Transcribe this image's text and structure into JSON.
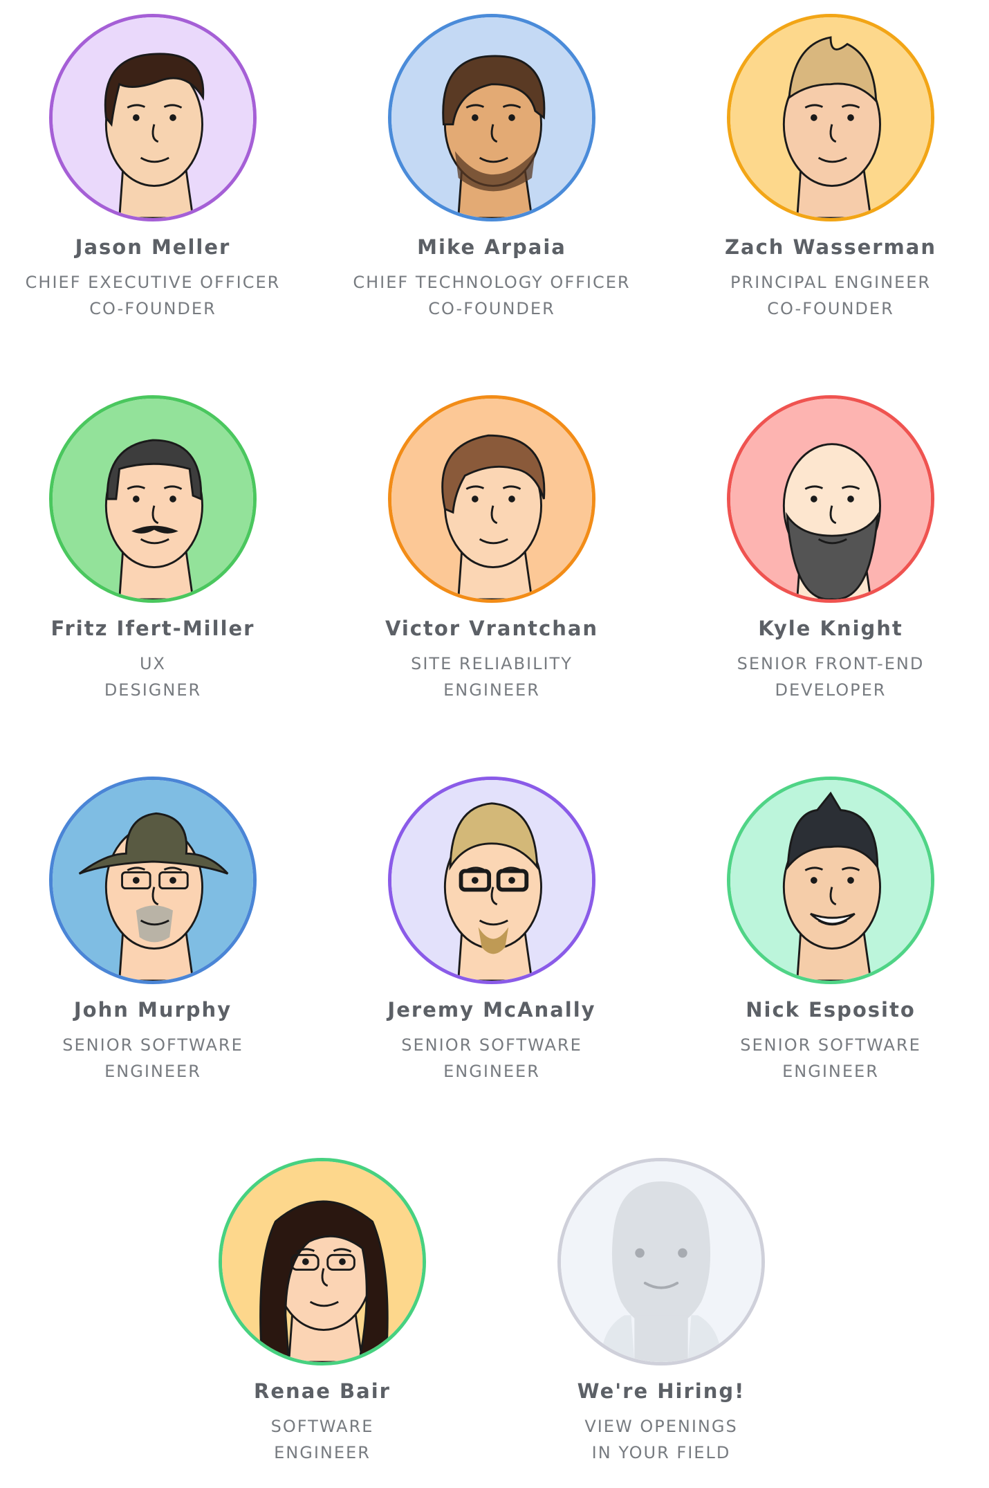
{
  "team": [
    {
      "name": "Jason Meller",
      "role_line1": "CHIEF EXECUTIVE OFFICER",
      "role_line2": "CO-FOUNDER",
      "ring": "#a55fd6",
      "bg": "#ead9fb",
      "skin": "#f7d3b0",
      "hair": "#3b2216",
      "avatar_icon": "jason-portrait-icon"
    },
    {
      "name": "Mike Arpaia",
      "role_line1": "CHIEF TECHNOLOGY OFFICER",
      "role_line2": "CO-FOUNDER",
      "ring": "#4a8bd9",
      "bg": "#c4d9f4",
      "skin": "#e3aa74",
      "hair": "#5a3a24",
      "avatar_icon": "mike-portrait-icon"
    },
    {
      "name": "Zach Wasserman",
      "role_line1": "PRINCIPAL ENGINEER",
      "role_line2": "CO-FOUNDER",
      "ring": "#f2a516",
      "bg": "#fdd88c",
      "skin": "#f6ccaa",
      "hair": "#d9b77e",
      "avatar_icon": "zach-portrait-icon"
    },
    {
      "name": "Fritz Ifert-Miller",
      "role_line1": "UX",
      "role_line2": "DESIGNER",
      "ring": "#4ac75e",
      "bg": "#93e29a",
      "skin": "#fbd4b4",
      "hair": "#3d3d3d",
      "avatar_icon": "fritz-portrait-icon"
    },
    {
      "name": "Victor Vrantchan",
      "role_line1": "SITE RELIABILITY",
      "role_line2": "ENGINEER",
      "ring": "#f28c17",
      "bg": "#fcc896",
      "skin": "#fbd6b4",
      "hair": "#8a5a3a",
      "avatar_icon": "victor-portrait-icon"
    },
    {
      "name": "Kyle Knight",
      "role_line1": "SENIOR FRONT-END",
      "role_line2": "DEVELOPER",
      "ring": "#ef5350",
      "bg": "#fdb4b1",
      "skin": "#fde6cf",
      "hair": "#545454",
      "avatar_icon": "kyle-portrait-icon"
    },
    {
      "name": "John Murphy",
      "role_line1": "SENIOR SOFTWARE",
      "role_line2": "ENGINEER",
      "ring": "#4a85d6",
      "bg": "#7fbde3",
      "skin": "#fbd3b2",
      "hair": "#595a42",
      "avatar_icon": "john-portrait-icon"
    },
    {
      "name": "Jeremy McAnally",
      "role_line1": "SENIOR SOFTWARE",
      "role_line2": "ENGINEER",
      "ring": "#8a5be8",
      "bg": "#e3e1fb",
      "skin": "#fbd6b4",
      "hair": "#d3b878",
      "avatar_icon": "jeremy-portrait-icon"
    },
    {
      "name": "Nick Esposito",
      "role_line1": "SENIOR SOFTWARE",
      "role_line2": "ENGINEER",
      "ring": "#4fd486",
      "bg": "#bcf5db",
      "skin": "#f5cda9",
      "hair": "#2b2f35",
      "avatar_icon": "nick-portrait-icon"
    },
    {
      "name": "Renae Bair",
      "role_line1": "SOFTWARE",
      "role_line2": "ENGINEER",
      "ring": "#47d180",
      "bg": "#fdd78c",
      "skin": "#fbd4b4",
      "hair": "#2a1710",
      "avatar_icon": "renae-portrait-icon"
    }
  ],
  "hiring": {
    "name": "We're Hiring!",
    "role_line1": "VIEW OPENINGS",
    "role_line2": "IN YOUR FIELD",
    "ring": "#cfd0da",
    "bg": "#f1f4f9",
    "silhouette": "#dbdfe4",
    "avatar_icon": "placeholder-person-icon"
  }
}
